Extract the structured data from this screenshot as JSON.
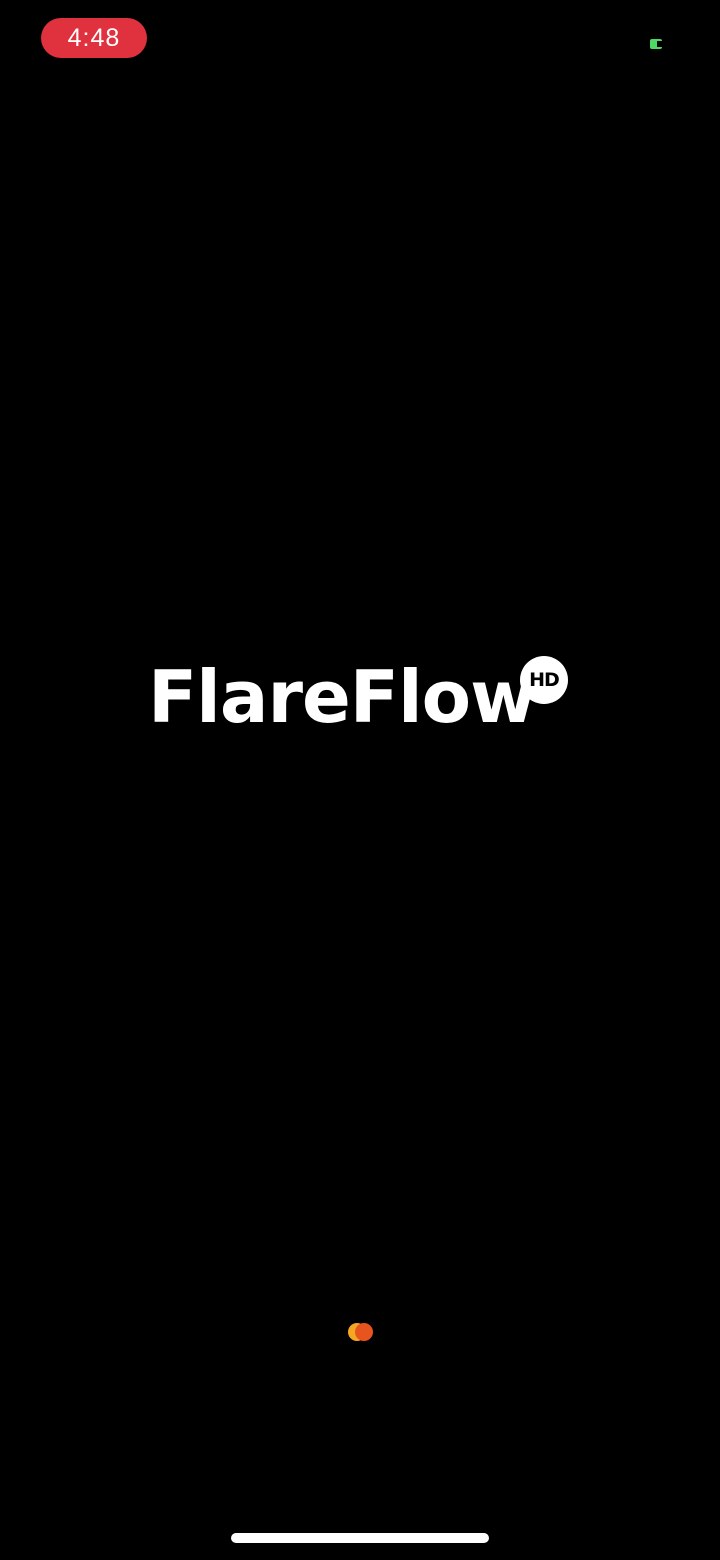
{
  "status_bar": {
    "time": "4:48",
    "time_pill_color": "#e0313e",
    "battery_color": "#4cd964",
    "battery_icon": "battery-charging-icon"
  },
  "splash": {
    "logo_text": "FlareFlow",
    "badge_text": "HD",
    "logo_color": "#ffffff",
    "background_color": "#000000"
  },
  "loader": {
    "icon": "loading-dots-icon",
    "colors": [
      "#f5a623",
      "#e8541e"
    ]
  },
  "home_indicator": {
    "color": "#ffffff"
  }
}
